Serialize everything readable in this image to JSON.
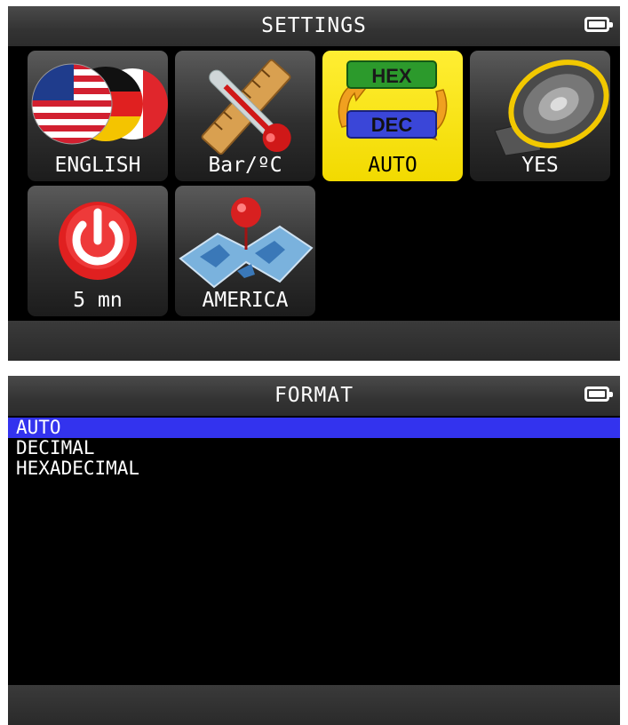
{
  "settings_screen": {
    "title": "SETTINGS",
    "tiles": [
      {
        "label": "ENGLISH",
        "icon": "flags-icon"
      },
      {
        "label": "Bar/ºC",
        "icon": "ruler-thermometer-icon"
      },
      {
        "label": "AUTO",
        "icon": "hex-dec-icon",
        "selected": true,
        "icon_text_top": "HEX",
        "icon_text_bottom": "DEC"
      },
      {
        "label": "YES",
        "icon": "speaker-icon"
      },
      {
        "label": "5 mn",
        "icon": "power-icon"
      },
      {
        "label": "AMERICA",
        "icon": "map-icon"
      }
    ]
  },
  "format_screen": {
    "title": "FORMAT",
    "options": [
      {
        "label": "AUTO",
        "selected": true
      },
      {
        "label": "DECIMAL"
      },
      {
        "label": "HEXADECIMAL"
      }
    ]
  },
  "colors": {
    "selection_yellow": "#f5e000",
    "selection_blue": "#3333ee",
    "screen_background": "#000000"
  }
}
